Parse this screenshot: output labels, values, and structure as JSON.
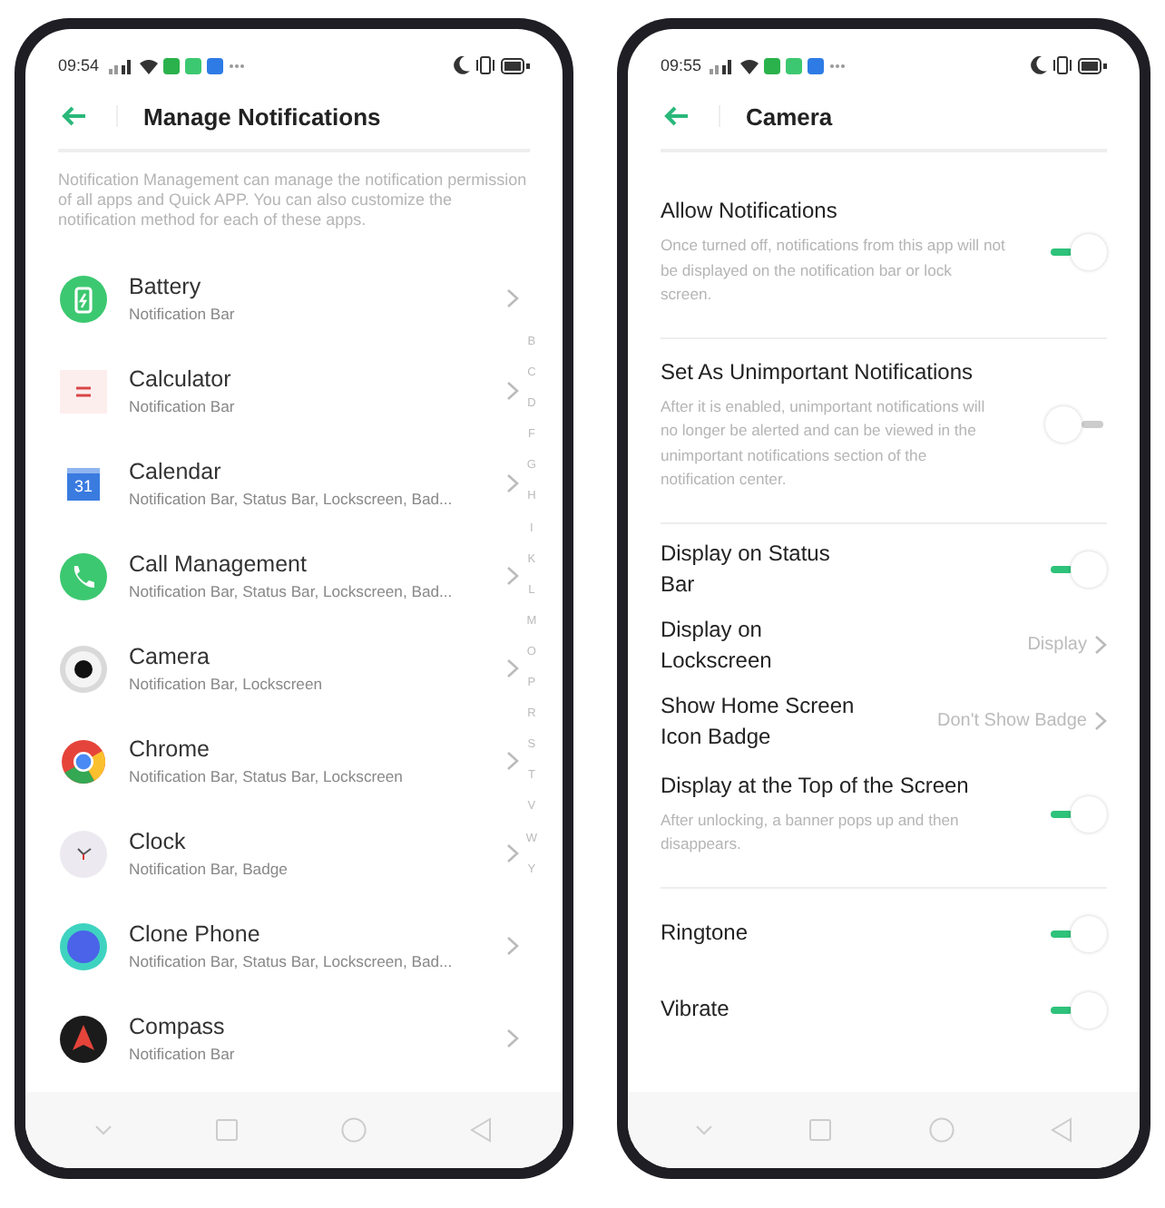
{
  "phones": [
    {
      "status_bar": {
        "time": "09:54"
      },
      "header": {
        "title": "Manage Notifications"
      },
      "description": "Notification Management can manage the notification permission of all apps and Quick APP. You can also customize the notification method for each of these apps.",
      "apps": [
        {
          "name": "Battery",
          "methods": "Notification Bar",
          "kind": "battery"
        },
        {
          "name": "Calculator",
          "methods": "Notification Bar",
          "kind": "calculator"
        },
        {
          "name": "Calendar",
          "methods": "Notification Bar, Status Bar, Lockscreen, Bad...",
          "kind": "calendar",
          "icon_text": "31"
        },
        {
          "name": "Call Management",
          "methods": "Notification Bar, Status Bar, Lockscreen, Bad...",
          "kind": "phone"
        },
        {
          "name": "Camera",
          "methods": "Notification Bar, Lockscreen",
          "kind": "camera"
        },
        {
          "name": "Chrome",
          "methods": "Notification Bar, Status Bar, Lockscreen",
          "kind": "chrome"
        },
        {
          "name": "Clock",
          "methods": "Notification Bar, Badge",
          "kind": "clock"
        },
        {
          "name": "Clone Phone",
          "methods": "Notification Bar, Status Bar, Lockscreen, Bad...",
          "kind": "clone"
        },
        {
          "name": "Compass",
          "methods": "Notification Bar",
          "kind": "compass"
        }
      ],
      "index_letters": [
        "B",
        "C",
        "D",
        "F",
        "G",
        "H",
        "I",
        "K",
        "L",
        "M",
        "O",
        "P",
        "R",
        "S",
        "T",
        "V",
        "W",
        "Y"
      ]
    },
    {
      "status_bar": {
        "time": "09:55"
      },
      "header": {
        "title": "Camera"
      },
      "sections": [
        [
          {
            "kind": "toggle",
            "label": "Allow Notifications",
            "description": "Once turned off, notifications from this app will not be displayed on the notification bar or lock screen.",
            "on": true
          }
        ],
        [
          {
            "kind": "toggle",
            "label": "Set As Unimportant Notifications",
            "description": "After it is enabled, unimportant notifications will no longer be alerted and can be viewed in the unimportant notifications section of the notification center.",
            "on": false
          }
        ],
        [
          {
            "kind": "toggle",
            "label": "Display on Status Bar",
            "on": true
          },
          {
            "kind": "link",
            "label": "Display on Lockscreen",
            "value": "Display"
          },
          {
            "kind": "link",
            "label": "Show Home Screen Icon Badge",
            "value": "Don't Show Badge"
          },
          {
            "kind": "toggle",
            "label": "Display at the Top of the Screen",
            "description": "After unlocking, a banner pops up and then disappears.",
            "on": true
          }
        ],
        [
          {
            "kind": "toggle",
            "label": "Ringtone",
            "on": true
          },
          {
            "kind": "toggle",
            "label": "Vibrate",
            "on": true
          }
        ]
      ]
    }
  ]
}
